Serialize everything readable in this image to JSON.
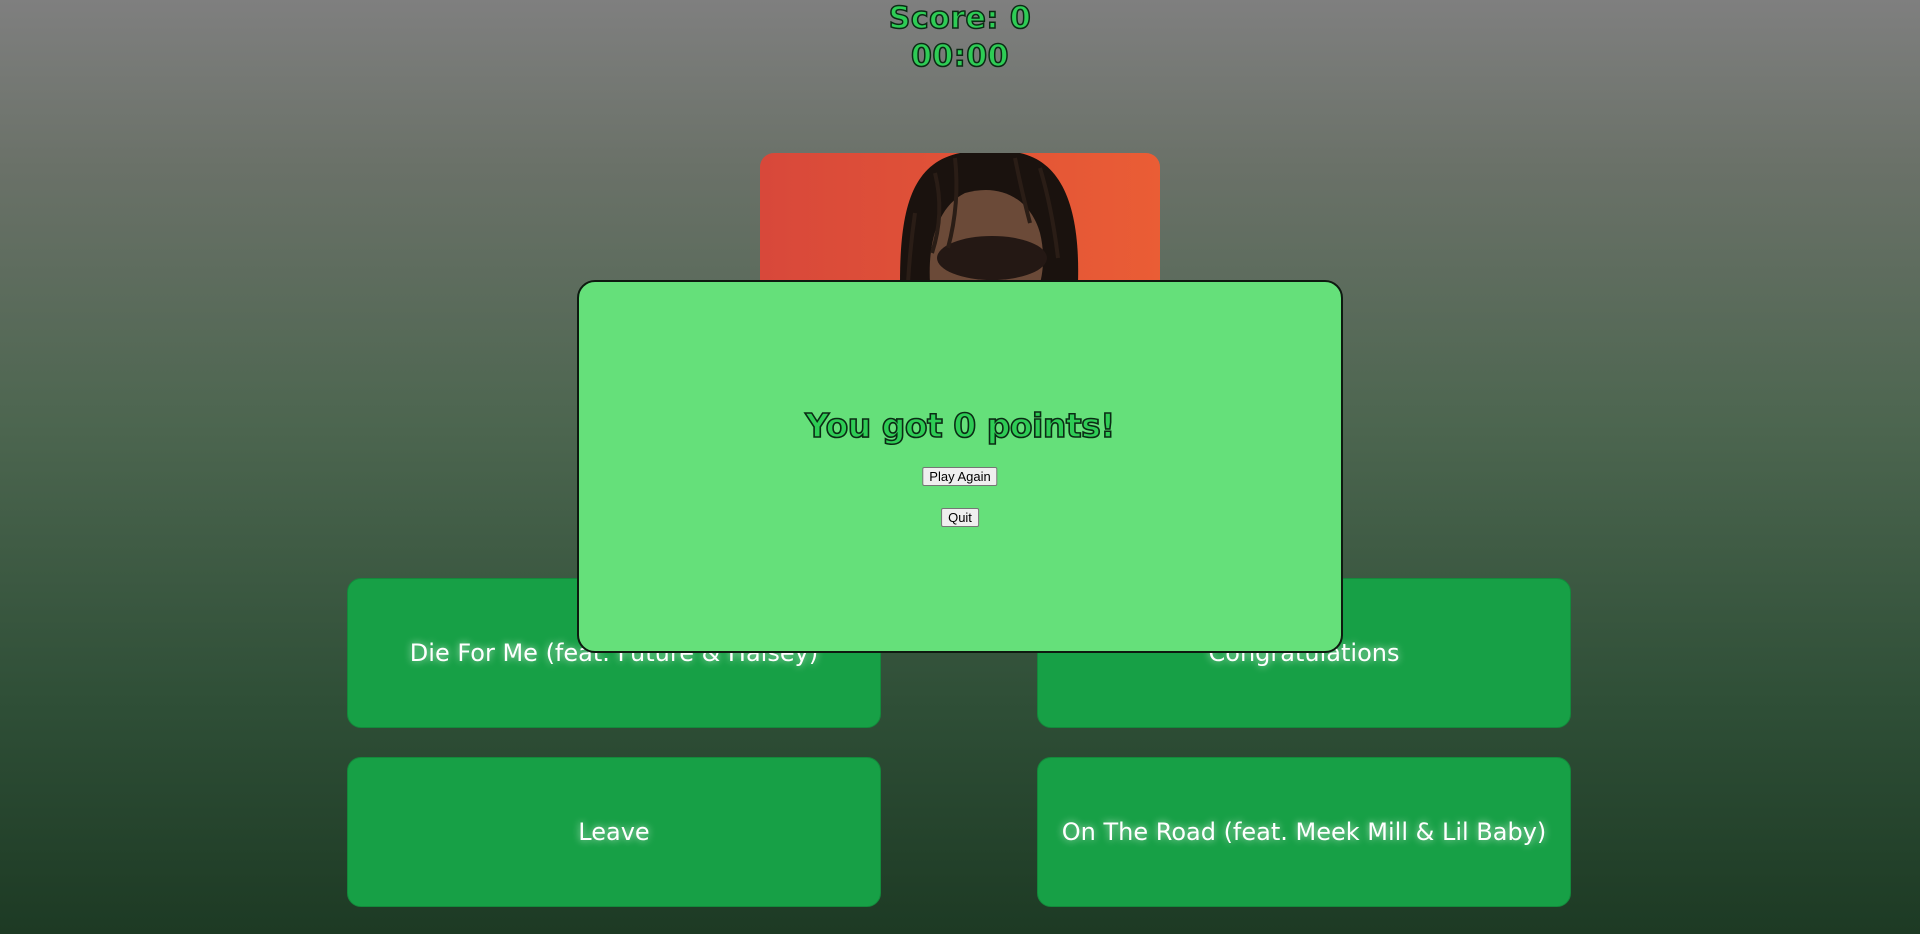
{
  "hud": {
    "score_text": "Score: 0",
    "timer_text": "00:00"
  },
  "cover_art": {
    "icon": "album-cover-image",
    "colors": {
      "background": "#e2553a",
      "hair": "#1a120e",
      "skin": "#6b4a38"
    }
  },
  "answers": [
    {
      "label": "Die For Me (feat. Future & Halsey)"
    },
    {
      "label": "Congratulations"
    },
    {
      "label": "Leave"
    },
    {
      "label": "On The Road (feat. Meek Mill & Lil Baby)"
    }
  ],
  "modal": {
    "title": "You got 0 points!",
    "play_again_label": "Play Again",
    "quit_label": "Quit"
  },
  "colors": {
    "answer_bg": "#17a046",
    "modal_bg": "#65e07a",
    "text_accent": "#2ecc55"
  }
}
